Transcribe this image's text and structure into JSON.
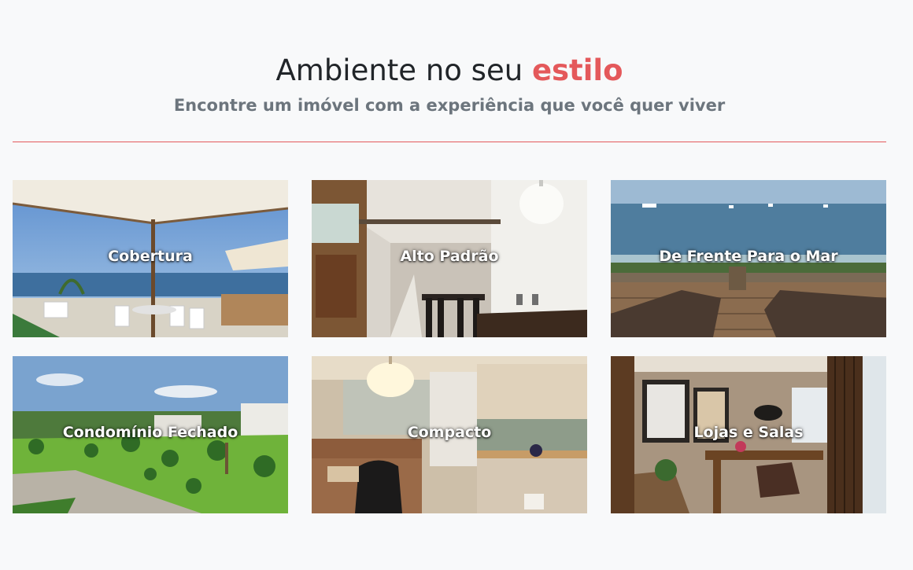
{
  "header": {
    "title_prefix": "Ambiente no seu ",
    "title_accent": "estilo",
    "subtitle": "Encontre um imóvel com a experiência que você quer viver"
  },
  "colors": {
    "accent": "#e4595b",
    "title": "#212529",
    "subtitle": "#6c757d",
    "background": "#f8f9fa"
  },
  "categories": [
    {
      "label": "Cobertura"
    },
    {
      "label": "Alto Padrão"
    },
    {
      "label": "De Frente Para o Mar"
    },
    {
      "label": "Condomínio Fechado"
    },
    {
      "label": "Compacto"
    },
    {
      "label": "Lojas e Salas"
    }
  ]
}
